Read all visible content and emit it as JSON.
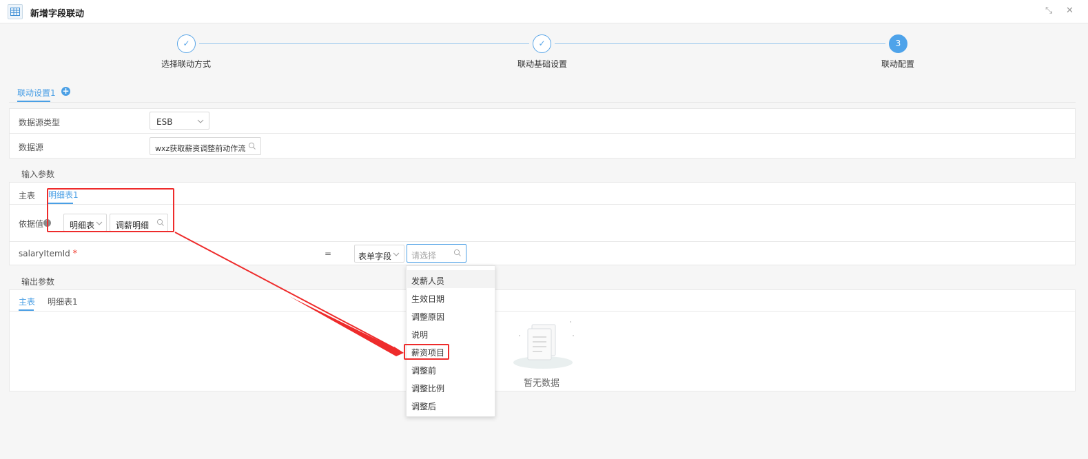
{
  "window": {
    "title": "新增字段联动",
    "minimize_glyph": "⤡",
    "close_glyph": "✕"
  },
  "steps": [
    {
      "label": "选择联动方式",
      "state": "done",
      "glyph": "✓"
    },
    {
      "label": "联动基础设置",
      "state": "done",
      "glyph": "✓"
    },
    {
      "label": "联动配置",
      "state": "active",
      "glyph": "3"
    }
  ],
  "link_tabs": {
    "items": [
      {
        "label": "联动设置1",
        "active": true
      }
    ],
    "add_glyph": "+"
  },
  "basic": {
    "source_type_label": "数据源类型",
    "source_type_value": "ESB",
    "source_label": "数据源",
    "source_value": "wxz获取薪资调整前动作流"
  },
  "input_params": {
    "title": "输入参数",
    "tabs": [
      {
        "label": "主表",
        "active": false
      },
      {
        "label": "明细表1",
        "active": true
      }
    ],
    "basis_label": "依据值",
    "basis_select": "明细表",
    "basis_search": "调薪明细",
    "field_name": "salaryItemId",
    "required_mark": "*",
    "equals": "=",
    "field_type": "表单字段",
    "field_placeholder": "请选择"
  },
  "dropdown": {
    "options": [
      "发薪人员",
      "生效日期",
      "调整原因",
      "说明",
      "薪资项目",
      "调整前",
      "调整比例",
      "调整后"
    ],
    "highlighted": "薪资项目"
  },
  "output_params": {
    "title": "输出参数",
    "tabs": [
      {
        "label": "主表",
        "active": true
      },
      {
        "label": "明细表1",
        "active": false
      }
    ],
    "empty_text": "暂无数据"
  },
  "colors": {
    "accent": "#4a9fe5",
    "annotation": "#ee2b2b",
    "required": "#f04134"
  }
}
